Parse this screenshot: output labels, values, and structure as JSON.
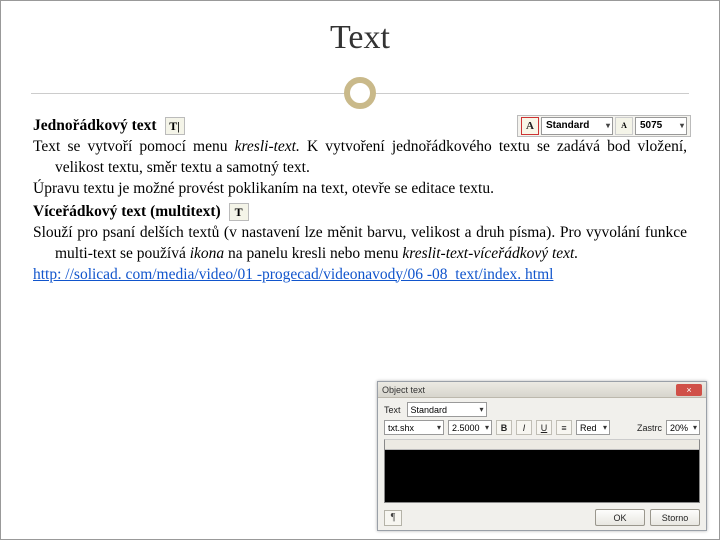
{
  "title": "Text",
  "content": {
    "h1": "Jednořádkový text",
    "p1": "Text se vytvoří pomocí menu kresli-text. K vytvoření jednořádkového textu se zadává bod vložení, velikost textu, směr textu a samotný text.",
    "p1_italic": "kresli-text.",
    "p2": "Úpravu textu je možné provést poklikaním na text, otevře se editace textu.",
    "h2": "Víceřádkový text (multitext)",
    "p3": "Slouží pro psaní delších textů (v nastavení lze měnit barvu, velikost a druh písma). Pro vyvolání funkce multi-text se používá ikona na panelu kresli nebo menu kreslit-text-víceřádkový text.",
    "p3_italic1": "ikona",
    "p3_italic2": "kreslit-text-víceřádkový text.",
    "link": "http: //solicad. com/media/video/01 -progecad/videonavody/06 -08_text/index. html"
  },
  "icons": {
    "single_text": "T|",
    "multi_text": "T"
  },
  "toolbar": {
    "a_label": "A",
    "style": "Standard",
    "size": "5075"
  },
  "dialog": {
    "title": "Object text",
    "close": "×",
    "label_text": "Text",
    "style": "Standard",
    "font": "txt.shx",
    "height": "2.5000",
    "bold": "B",
    "italic": "I",
    "underline": "U",
    "color_lbl": "Red",
    "extra_lbl": "Zastrc",
    "extra_val": "20%",
    "prop_btn": "¶",
    "ok": "OK",
    "cancel": "Storno"
  }
}
